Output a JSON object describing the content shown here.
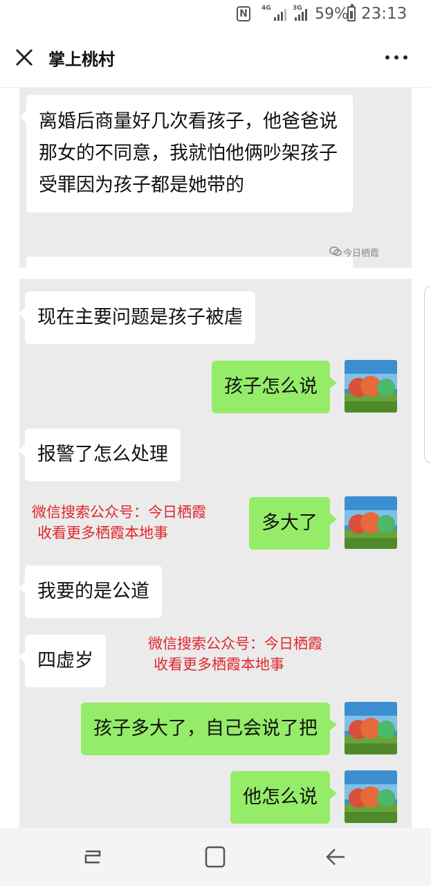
{
  "status_bar": {
    "nfc_label": "N",
    "net_4g": "4G",
    "net_3g": "3G",
    "battery_percent": "59%",
    "time": "23:13"
  },
  "header": {
    "title": "掌上桃村"
  },
  "screenshot_1": {
    "message": "离婚后商量好几次看孩子，他爸爸说那女的不同意，我就怕他俩吵架孩子受罪因为孩子都是她带的",
    "watermark": "今日栖霞"
  },
  "messages": [
    {
      "side": "left",
      "text": "现在主要问题是孩子被虐"
    },
    {
      "side": "right",
      "text": "孩子怎么说"
    },
    {
      "side": "left",
      "text": "报警了怎么处理"
    },
    {
      "side": "right",
      "text": "多大了"
    },
    {
      "side": "left",
      "text": "我要的是公道"
    },
    {
      "side": "left",
      "text": "四虚岁"
    },
    {
      "side": "right",
      "text": "孩子多大了，自己会说了把"
    },
    {
      "side": "right",
      "text": "他怎么说"
    }
  ],
  "overlays": [
    {
      "line1": "微信搜索公众号：今日栖霞",
      "line2": "收看更多栖霞本地事"
    },
    {
      "line1": "微信搜索公众号：今日栖霞",
      "line2": "收看更多栖霞本地事"
    }
  ],
  "colors": {
    "bubble_green": "#95ec69",
    "bubble_white": "#ffffff",
    "chat_background": "#ebebeb",
    "overlay_red": "#e0262e"
  },
  "icons": {
    "close": "close-icon",
    "more": "more-icon",
    "recent_apps": "recent-apps-icon",
    "home": "home-icon",
    "back": "back-icon"
  }
}
